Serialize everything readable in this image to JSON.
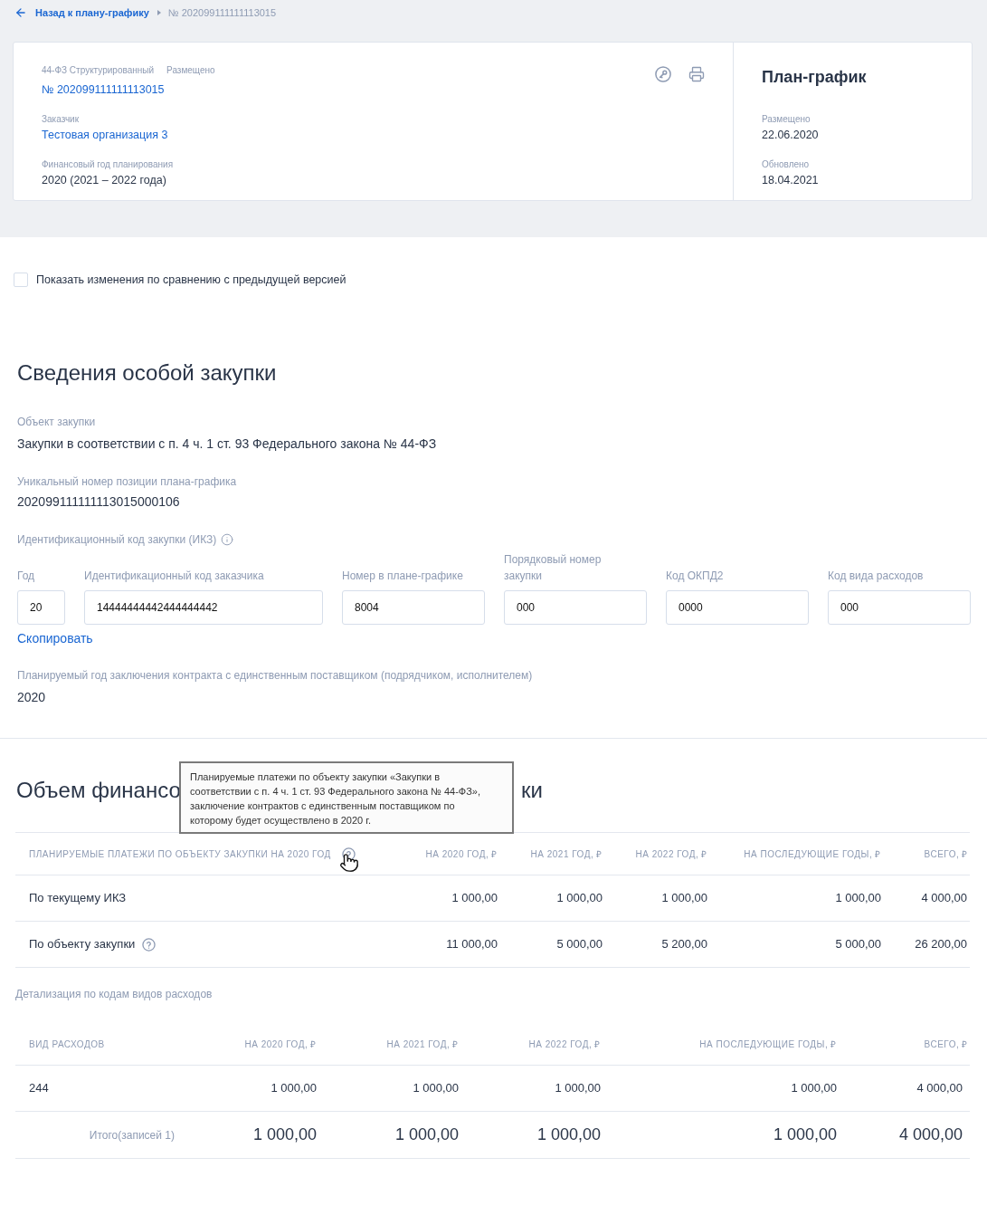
{
  "breadcrumb": {
    "back_link": "Назад к плану-графику",
    "current": "№ 202099111111113015"
  },
  "summary_card": {
    "tags": [
      "44-ФЗ Структурированный",
      "Размещено"
    ],
    "number": "№ 202099111111113015",
    "fields": [
      {
        "label": "Заказчик",
        "value": "Тестовая организация 3",
        "kind": "link"
      },
      {
        "label": "Финансовый год планирования",
        "value": "2020 (2021 – 2022 года)",
        "kind": "text"
      }
    ],
    "side": {
      "title": "План-график",
      "fields": [
        {
          "label": "Размещено",
          "value": "22.06.2020"
        },
        {
          "label": "Обновлено",
          "value": "18.04.2021"
        }
      ]
    }
  },
  "compare_checkbox": {
    "label": "Показать изменения по сравнению с предыдущей версией",
    "checked": false
  },
  "special_purchase": {
    "title": "Сведения особой закупки",
    "fields": [
      {
        "label": "Объект закупки",
        "value": "Закупки в соответствии с п. 4 ч. 1 ст. 93 Федерального закона № 44-ФЗ"
      },
      {
        "label": "Уникальный номер позиции плана-графика",
        "value": "202099111111113015000106"
      }
    ],
    "ikz": {
      "label": "Идентификационный код закупки (ИКЗ)",
      "parts": [
        {
          "label": "Год",
          "value": "20"
        },
        {
          "label": "Идентификационный код заказчика",
          "value": "14444444442444444442"
        },
        {
          "label": "Номер в плане-графике",
          "value": "8004"
        },
        {
          "label": "Порядковый номер закупки",
          "value": "000"
        },
        {
          "label": "Код ОКПД2",
          "value": "0000"
        },
        {
          "label": "Код вида расходов",
          "value": "000"
        }
      ],
      "copy_link": "Скопировать"
    },
    "planned_year": {
      "label": "Планируемый год заключения контракта с единственным поставщиком (подрядчиком, исполнителем)",
      "value": "2020"
    }
  },
  "financing": {
    "title_parts": [
      "Объем финансо",
      "ки"
    ],
    "tooltip": "Планируемые платежи по объекту закупки «Закупки в соответствии с п. 4 ч. 1 ст. 93 Федерального закона № 44-ФЗ», заключение контрактов с единственным поставщиком по которому будет осуществлено в 2020 г.",
    "payments_table": {
      "columns": [
        {
          "label": "ПЛАНИРУЕМЫЕ ПЛАТЕЖИ ПО ОБЪЕКТУ ЗАКУПКИ НА 2020 ГОД",
          "help": true
        },
        {
          "label": "НА 2020 ГОД, ₽",
          "help": false
        },
        {
          "label": "НА 2021 ГОД, ₽",
          "help": false
        },
        {
          "label": "НА 2022 ГОД, ₽",
          "help": false
        },
        {
          "label": "НА ПОСЛЕДУЮЩИЕ ГОДЫ, ₽",
          "help": false
        },
        {
          "label": "ВСЕГО, ₽",
          "help": false
        }
      ],
      "rows": [
        {
          "cells": [
            "По текущему ИКЗ",
            "1 000,00",
            "1 000,00",
            "1 000,00",
            "1 000,00",
            "4 000,00"
          ],
          "help": false
        },
        {
          "cells": [
            "По объекту закупки",
            "11 000,00",
            "5 000,00",
            "5 200,00",
            "5 000,00",
            "26 200,00"
          ],
          "help": true
        }
      ]
    },
    "detail_caption": "Детализация по кодам видов расходов",
    "detail_table": {
      "columns": [
        "ВИД РАСХОДОВ",
        "НА 2020 ГОД, ₽",
        "НА 2021 ГОД, ₽",
        "НА 2022 ГОД, ₽",
        "НА ПОСЛЕДУЮЩИЕ ГОДЫ, ₽",
        "ВСЕГО, ₽"
      ],
      "rows": [
        [
          "244",
          "1 000,00",
          "1 000,00",
          "1 000,00",
          "1 000,00",
          "4 000,00"
        ]
      ],
      "total": {
        "label": "Итого(записей 1)",
        "values": [
          "1 000,00",
          "1 000,00",
          "1 000,00",
          "1 000,00",
          "4 000,00"
        ]
      }
    }
  }
}
